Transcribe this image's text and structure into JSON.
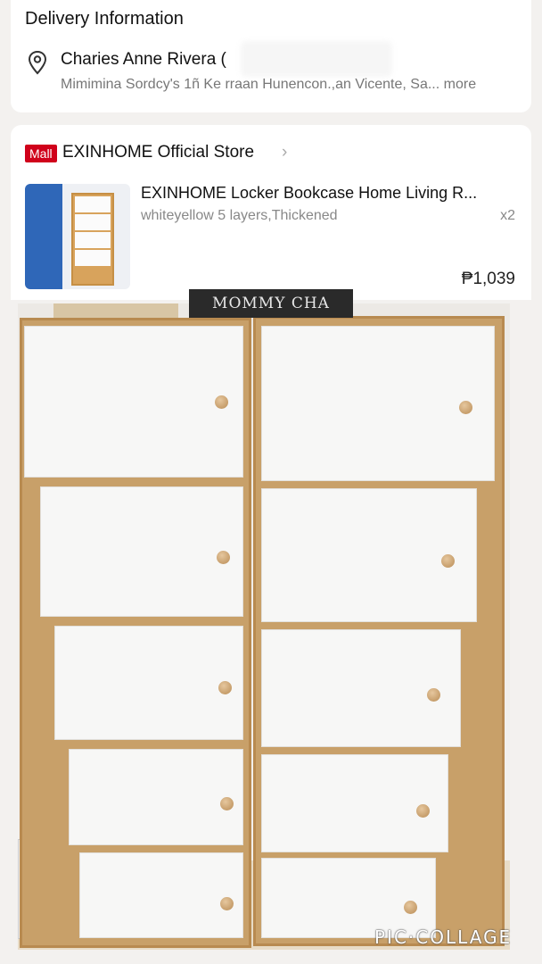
{
  "delivery": {
    "title": "Delivery Information",
    "name": "Charies Anne Rivera (",
    "address": "Mimimina Sordcy's 1ñ Ke rraan Hunencon.,an Vicente, Sa...",
    "more_label": "more",
    "icon": "location-pin-icon"
  },
  "store": {
    "badge": "Mall",
    "name": "EXINHOME Official Store",
    "chevron": "›"
  },
  "product": {
    "title": "EXINHOME Locker Bookcase Home Living R...",
    "variant": "whiteyellow 5 layers,Thickened",
    "qty": "x2",
    "price": "₱1,039"
  },
  "photo": {
    "watermark": "MOMMY CHA",
    "collage_label": "PIC·COLLAGE"
  },
  "colors": {
    "mall_red": "#d0011b",
    "wood": "#c8a069",
    "door_white": "#f7f7f6"
  }
}
